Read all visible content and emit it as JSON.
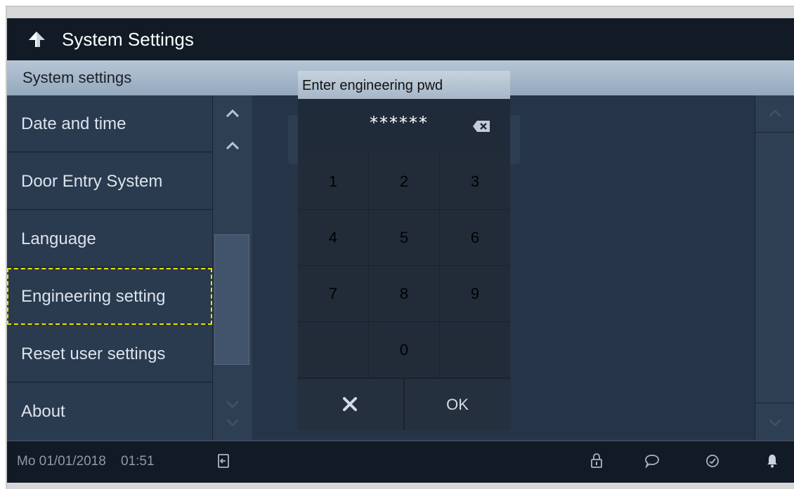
{
  "header": {
    "title": "System Settings",
    "back_icon": "up-arrow-icon"
  },
  "section": {
    "title": "System settings"
  },
  "menu": {
    "items": [
      {
        "label": "Date and time"
      },
      {
        "label": "Door Entry System"
      },
      {
        "label": "Language"
      },
      {
        "label": "Engineering setting",
        "selected": true
      },
      {
        "label": "Reset user settings"
      },
      {
        "label": "About"
      }
    ]
  },
  "dialog": {
    "title": "Enter engineering pwd",
    "password_value": "******",
    "keys": [
      "1",
      "2",
      "3",
      "4",
      "5",
      "6",
      "7",
      "8",
      "9",
      "0"
    ],
    "cancel_icon": "close-icon",
    "ok_label": "OK",
    "backspace_icon": "backspace-icon"
  },
  "status": {
    "date": "Mo 01/01/2018",
    "time": "01:51",
    "icons": [
      "door-exit-icon",
      "lock-icon",
      "chat-icon",
      "clock-icon",
      "bell-icon"
    ]
  },
  "colors": {
    "accent_dashed": "#e8e400",
    "background": "#263447",
    "titlebar": "#111a25"
  }
}
